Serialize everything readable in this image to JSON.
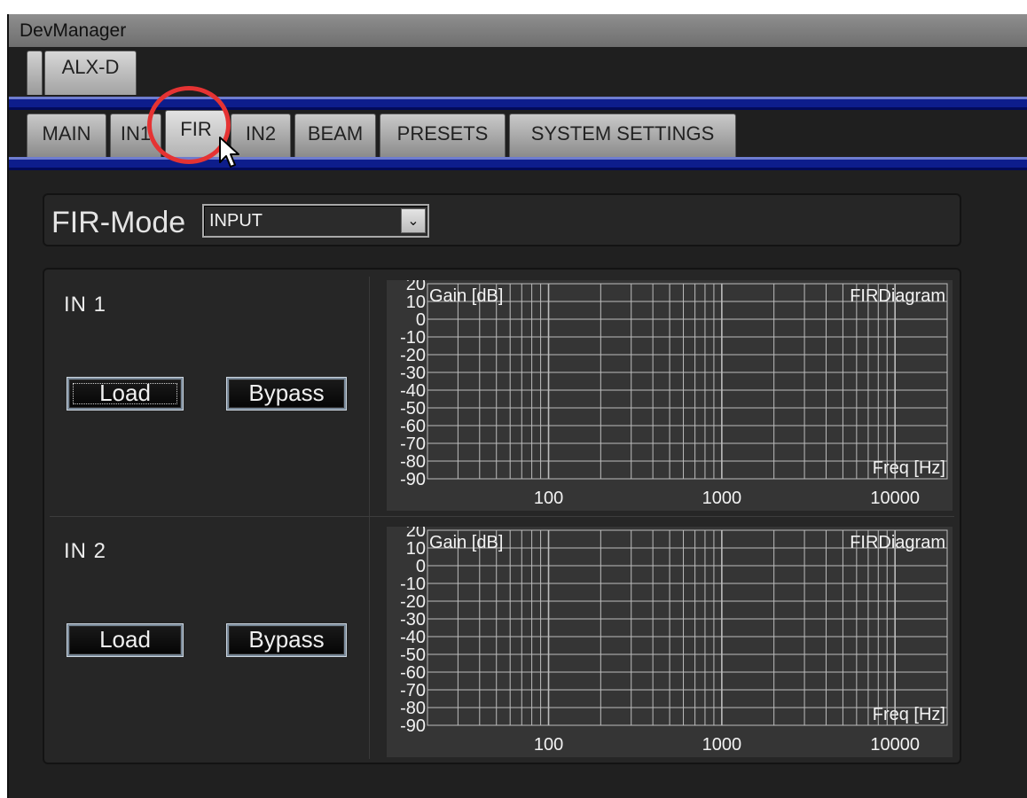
{
  "window": {
    "title": "DevManager"
  },
  "device_tabs": [
    {
      "label": "ALX-D"
    }
  ],
  "tabs": [
    {
      "label": "MAIN"
    },
    {
      "label": "IN1"
    },
    {
      "label": "FIR"
    },
    {
      "label": "IN2"
    },
    {
      "label": "BEAM"
    },
    {
      "label": "PRESETS"
    },
    {
      "label": "SYSTEM SETTINGS"
    }
  ],
  "active_tab": "FIR",
  "fir_mode": {
    "label": "FIR-Mode",
    "value": "INPUT"
  },
  "channels": [
    {
      "label": "IN  1",
      "load_label": "Load",
      "bypass_label": "Bypass"
    },
    {
      "label": "IN  2",
      "load_label": "Load",
      "bypass_label": "Bypass"
    }
  ],
  "chart_data": [
    {
      "type": "line",
      "title": "FIRDiagram",
      "ylabel": "Gain [dB]",
      "xlabel": "Freq [Hz]",
      "x_scale": "log",
      "xlim": [
        20,
        20000
      ],
      "ylim": [
        -90,
        20
      ],
      "yticks": [
        "20",
        "10",
        "0",
        "-10",
        "-20",
        "-30",
        "-40",
        "-50",
        "-60",
        "-70",
        "-80",
        "-90"
      ],
      "xticks": [
        "100",
        "1000",
        "10000"
      ],
      "grid": true,
      "series": []
    },
    {
      "type": "line",
      "title": "FIRDiagram",
      "ylabel": "Gain [dB]",
      "xlabel": "Freq [Hz]",
      "x_scale": "log",
      "xlim": [
        20,
        20000
      ],
      "ylim": [
        -90,
        20
      ],
      "yticks": [
        "20",
        "10",
        "0",
        "-10",
        "-20",
        "-30",
        "-40",
        "-50",
        "-60",
        "-70",
        "-80",
        "-90"
      ],
      "xticks": [
        "100",
        "1000",
        "10000"
      ],
      "grid": true,
      "series": []
    }
  ],
  "colors": {
    "title_bar": "#7f7f7f",
    "accent_band": "#0d1d8c",
    "focus_circle": "#e53333",
    "panel": "#262626",
    "chart_bg": "#353535",
    "grid": "#bdbdbd"
  }
}
